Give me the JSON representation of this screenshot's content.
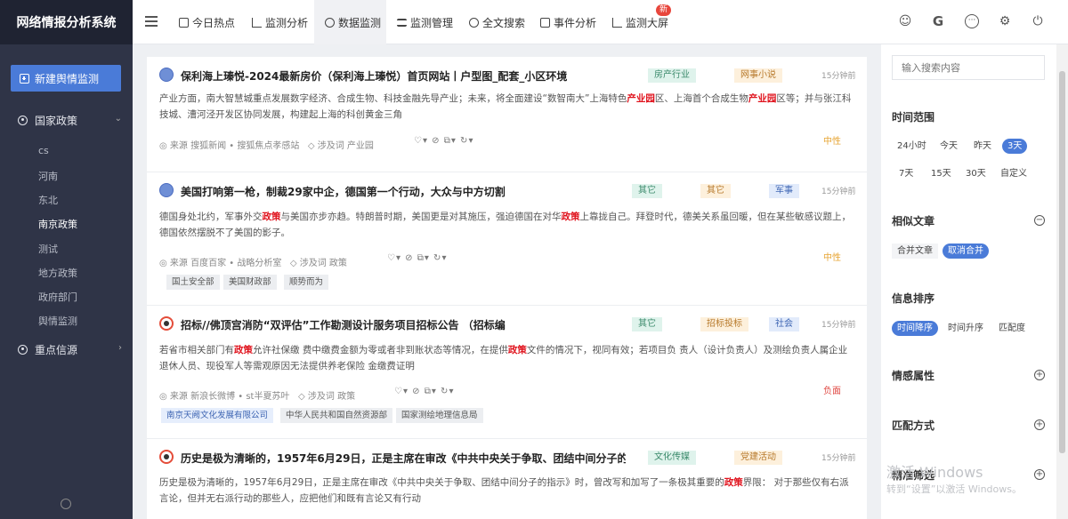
{
  "app": {
    "title": "网络情报分析系统"
  },
  "sidebar": {
    "new_button": "新建舆情监测",
    "groups": [
      {
        "label": "国家政策",
        "children": [
          "cs",
          "河南",
          "东北",
          "南京政策",
          "测试",
          "地方政策",
          "政府部门",
          "舆情监测"
        ]
      },
      {
        "label": "重点信源",
        "children": []
      }
    ],
    "active_child": "南京政策"
  },
  "topnav": {
    "items": [
      "今日热点",
      "监测分析",
      "数据监测",
      "监测管理",
      "全文搜索",
      "事件分析",
      "监测大屏"
    ],
    "active": "数据监测",
    "badge": "新"
  },
  "articles": [
    {
      "title": "保利海上瑧悦-2024最新房价（保利海上瑧悦）首页网站丨户型图_配套_小区环境",
      "tags": [
        "房产行业",
        "网事小说"
      ],
      "time_ago": "15分钟前",
      "body_parts": [
        {
          "t": "产业方面，南大智慧城重点发展数字经济、合成生物、科技金融先导产业；未来，将全面建设“数智南大”上海特色"
        },
        {
          "t": "产业园",
          "kw": true
        },
        {
          "t": "区、上海首个合成生物"
        },
        {
          "t": "产业园",
          "kw": true
        },
        {
          "t": "区等；并与张江科技城、漕河泾开发区协同发展，构建起上海的科创黄金三角"
        }
      ],
      "source": "来源 搜狐新闻 • 搜狐焦点孝感站",
      "keywords": "涉及词 产业园",
      "sentiment": "中性",
      "chips": []
    },
    {
      "title": "美国打响第一枪，制裁29家中企，德国第一个行动，大众与中方切割",
      "tags": [
        "其它",
        "其它",
        "军事"
      ],
      "time_ago": "15分钟前",
      "body_parts": [
        {
          "t": "德国身处北约，军事外交"
        },
        {
          "t": "政策",
          "kw": true
        },
        {
          "t": "与美国亦步亦趋。特朗普时期，美国更是对其施压，强迫德国在对华"
        },
        {
          "t": "政策",
          "kw": true
        },
        {
          "t": "上靠拢自己。拜登时代，德美关系虽回暖，但在某些敏感议题上，德国依然摆脱不了美国的影子。"
        }
      ],
      "source": "来源 百度百家 • 战略分析室",
      "keywords": "涉及词 政策",
      "sentiment": "中性",
      "chips": [
        "国土安全部",
        "美国财政部",
        "顺势而为"
      ]
    },
    {
      "title": "招标//佛顶宫消防“双评估”工作勘测设计服务项目招标公告 （招标编",
      "tags": [
        "其它",
        "招标投标",
        "社会"
      ],
      "time_ago": "15分钟前",
      "body_parts": [
        {
          "t": "若省市相关部门有"
        },
        {
          "t": "政策",
          "kw": true
        },
        {
          "t": "允许社保缴 费中缴费金额为零或者非到账状态等情况，在提供"
        },
        {
          "t": "政策",
          "kw": true
        },
        {
          "t": "文件的情况下，视同有效；若项目负 责人（设计负责人）及测绘负责人属企业退休人员、现役军人等需观原因无法提供养老保险 金缴费证明"
        }
      ],
      "source": "来源 新浪长微博 • st半夏苏叶",
      "keywords": "涉及词 政策",
      "sentiment": "负面",
      "chips": [
        "南京天阙文化发展有限公司",
        "中华人民共和国自然资源部",
        "国家测绘地理信息局"
      ]
    },
    {
      "title": "历史是极为清晰的，1957年6月29日，正是主席在审改《中共中央关于争取、团结中间分子的指...",
      "tags": [
        "文化传媒",
        "党建活动"
      ],
      "time_ago": "15分钟前",
      "body_parts": [
        {
          "t": "历史是极为清晰的，1957年6月29日，正是主席在审改《中共中央关于争取、团结中间分子的指示》时，曾改写和加写了一条极其重要的"
        },
        {
          "t": "政策",
          "kw": true
        },
        {
          "t": "界限： 对于那些仅有右派言论，但并无右派行动的那些人，应把他们和既有言论又有行动"
        }
      ],
      "source": "",
      "keywords": "",
      "sentiment": "",
      "chips": []
    }
  ],
  "filters": {
    "search_placeholder": "输入搜索内容",
    "time_range": {
      "label": "时间范围",
      "options": [
        "24小时",
        "今天",
        "昨天",
        "3天",
        "7天",
        "15天",
        "30天",
        "自定义"
      ],
      "selected": "3天"
    },
    "similar": {
      "label": "相似文章",
      "options": [
        "合并文章",
        "取消合并"
      ],
      "selected": "取消合并"
    },
    "sort": {
      "label": "信息排序",
      "options": [
        "时间降序",
        "时间升序",
        "匹配度"
      ],
      "selected": "时间降序"
    },
    "collapsed": [
      "情感属性",
      "匹配方式",
      "精准筛选"
    ]
  },
  "watermark": {
    "line1": "激活 Windows",
    "line2": "转到“设置”以激活 Windows。"
  }
}
